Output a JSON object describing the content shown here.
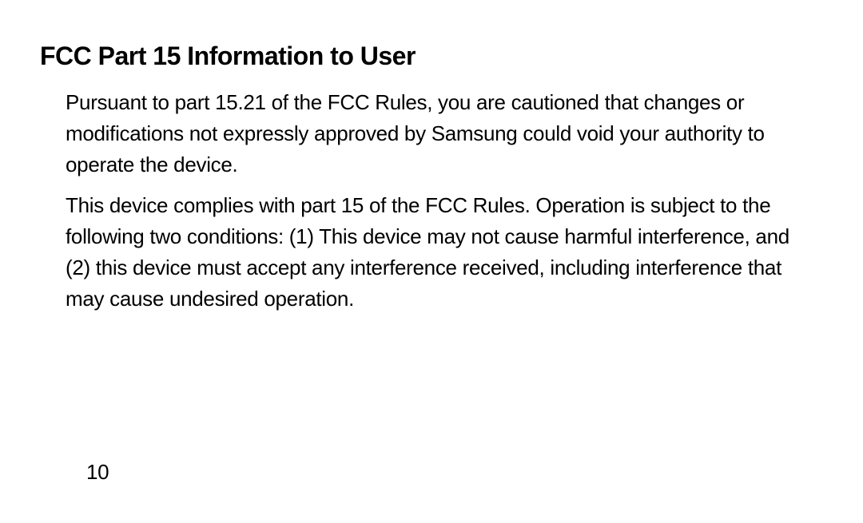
{
  "document": {
    "heading": "FCC Part 15 Information to User",
    "paragraphs": [
      "Pursuant to part 15.21 of the FCC Rules, you are cautioned that changes or modifications not expressly approved by Samsung could void your authority to operate the device.",
      "This device complies with part 15 of the FCC Rules. Operation is subject to the following two conditions: (1) This device may not cause harmful interference, and (2) this device must accept any interference received, including interference that may cause undesired operation."
    ],
    "page_number": "10"
  }
}
